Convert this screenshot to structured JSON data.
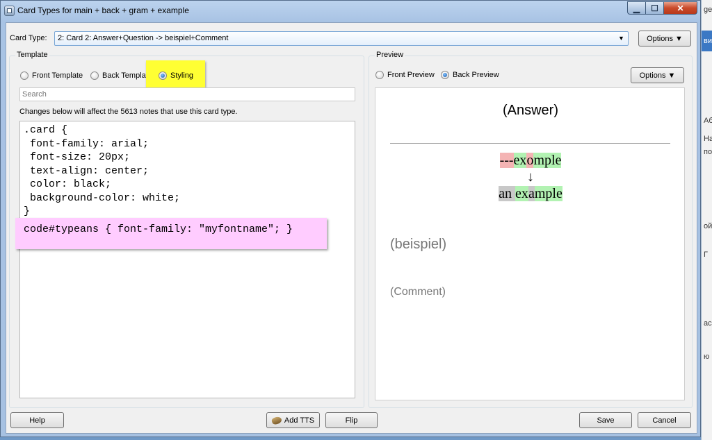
{
  "window": {
    "title": "Card Types for main + back + gram + example",
    "min_glyph": "▁",
    "max_glyph": "☐",
    "close_glyph": "✕"
  },
  "card_type": {
    "label": "Card Type:",
    "value": "2: Card 2: Answer+Question -> beispiel+Comment",
    "arrow": "▼",
    "options_button": "Options ▼"
  },
  "template": {
    "group_title": "Template",
    "radios": [
      {
        "label": "Front Template",
        "checked": false
      },
      {
        "label": "Back Template",
        "checked": false
      },
      {
        "label": "Styling",
        "checked": true
      }
    ],
    "search_placeholder": "Search",
    "notice": "Changes below will affect the 5613 notes that use this card type.",
    "css_lines": [
      ".card {",
      " font-family: arial;",
      " font-size: 20px;",
      " text-align: center;",
      " color: black;",
      " background-color: white;",
      "}"
    ],
    "css_highlight_line": "code#typeans { font-family: \"myfontname\"; }"
  },
  "preview": {
    "group_title": "Preview",
    "radios": [
      {
        "label": "Front Preview",
        "checked": false
      },
      {
        "label": "Back Preview",
        "checked": true
      }
    ],
    "options_button": "Options ▼",
    "answer_heading": "(Answer)",
    "typed_segments": [
      {
        "text": "---",
        "style": "red"
      },
      {
        "text": "ex",
        "style": "green"
      },
      {
        "text": "o",
        "style": "red"
      },
      {
        "text": "mple",
        "style": "green"
      }
    ],
    "arrow": "↓",
    "correct_segments": [
      {
        "text": "an ",
        "style": "gray"
      },
      {
        "text": "ex",
        "style": "green"
      },
      {
        "text": "a",
        "style": "gray"
      },
      {
        "text": "mple",
        "style": "green"
      }
    ],
    "beispiel": "(beispiel)",
    "comment": "(Comment)"
  },
  "buttons": {
    "help": "Help",
    "add_tts": "Add TTS",
    "flip": "Flip",
    "save": "Save",
    "cancel": "Cancel"
  },
  "background_app": {
    "texts": [
      "ge",
      "ви",
      "Аб",
      "На",
      "по",
      "ой",
      "Г",
      "ас",
      "ю Р"
    ]
  },
  "colors": {
    "highlight_yellow": "#ffff33",
    "highlight_pink": "#ffccff",
    "diff_red": "#f4b4b4",
    "diff_green": "#b2f2b2",
    "diff_gray": "#c8c8c8"
  }
}
